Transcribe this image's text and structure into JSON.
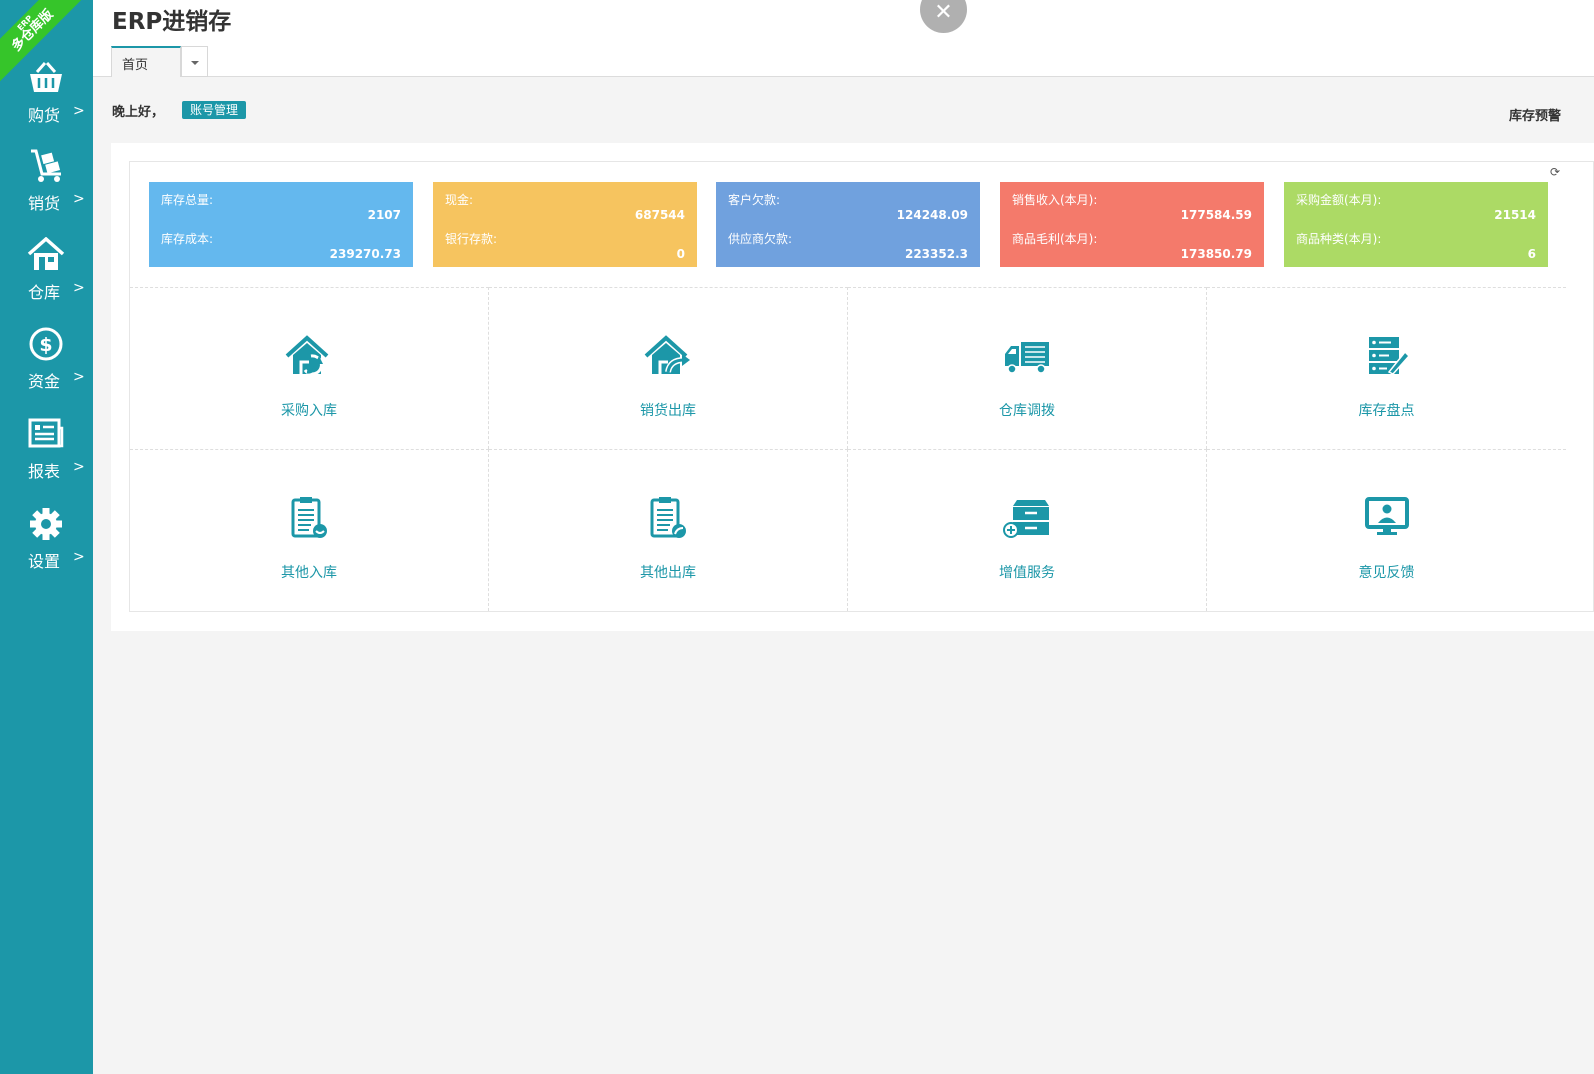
{
  "brand": {
    "ribbon_small": "ERP",
    "ribbon_big": "多仓库版",
    "ribbon_color": "#36c52a",
    "sidebar_color": "#1c97a8"
  },
  "sidebar": {
    "items": [
      {
        "label": "购货",
        "icon": "basket-icon"
      },
      {
        "label": "销货",
        "icon": "hand-truck-icon"
      },
      {
        "label": "仓库",
        "icon": "house-icon"
      },
      {
        "label": "资金",
        "icon": "dollar-icon"
      },
      {
        "label": "报表",
        "icon": "newspaper-icon"
      },
      {
        "label": "设置",
        "icon": "gear-icon"
      }
    ],
    "chevron": ">"
  },
  "header": {
    "title": "ERP进销存",
    "close_glyph": "✕"
  },
  "tabs": [
    {
      "label": "首页"
    }
  ],
  "greeting": {
    "text": "晚上好，",
    "account_button": "账号管理",
    "stock_alert": "库存预警"
  },
  "stats": [
    {
      "label1": "库存总量:",
      "value1": "2107",
      "label2": "库存成本:",
      "value2": "239270.73",
      "color": "#64b8ee"
    },
    {
      "label1": "现金:",
      "value1": "687544",
      "label2": "银行存款:",
      "value2": "0",
      "color": "#f6c45f"
    },
    {
      "label1": "客户欠款:",
      "value1": "124248.09",
      "label2": "供应商欠款:",
      "value2": "223352.3",
      "color": "#70a1de"
    },
    {
      "label1": "销售收入(本月):",
      "value1": "177584.59",
      "label2": "商品毛利(本月):",
      "value2": "173850.79",
      "color": "#f47a6b"
    },
    {
      "label1": "采购金额(本月):",
      "value1": "21514",
      "label2": "商品种类(本月):",
      "value2": "6",
      "color": "#acda65"
    }
  ],
  "shortcuts": [
    {
      "label": "采购入库",
      "icon": "house-in-icon"
    },
    {
      "label": "销货出库",
      "icon": "house-out-icon"
    },
    {
      "label": "仓库调拨",
      "icon": "truck-icon"
    },
    {
      "label": "库存盘点",
      "icon": "server-edit-icon"
    },
    {
      "label": "其他入库",
      "icon": "clipboard-in-icon"
    },
    {
      "label": "其他出库",
      "icon": "clipboard-out-icon"
    },
    {
      "label": "增值服务",
      "icon": "cabinet-add-icon"
    },
    {
      "label": "意见反馈",
      "icon": "monitor-user-icon"
    }
  ]
}
